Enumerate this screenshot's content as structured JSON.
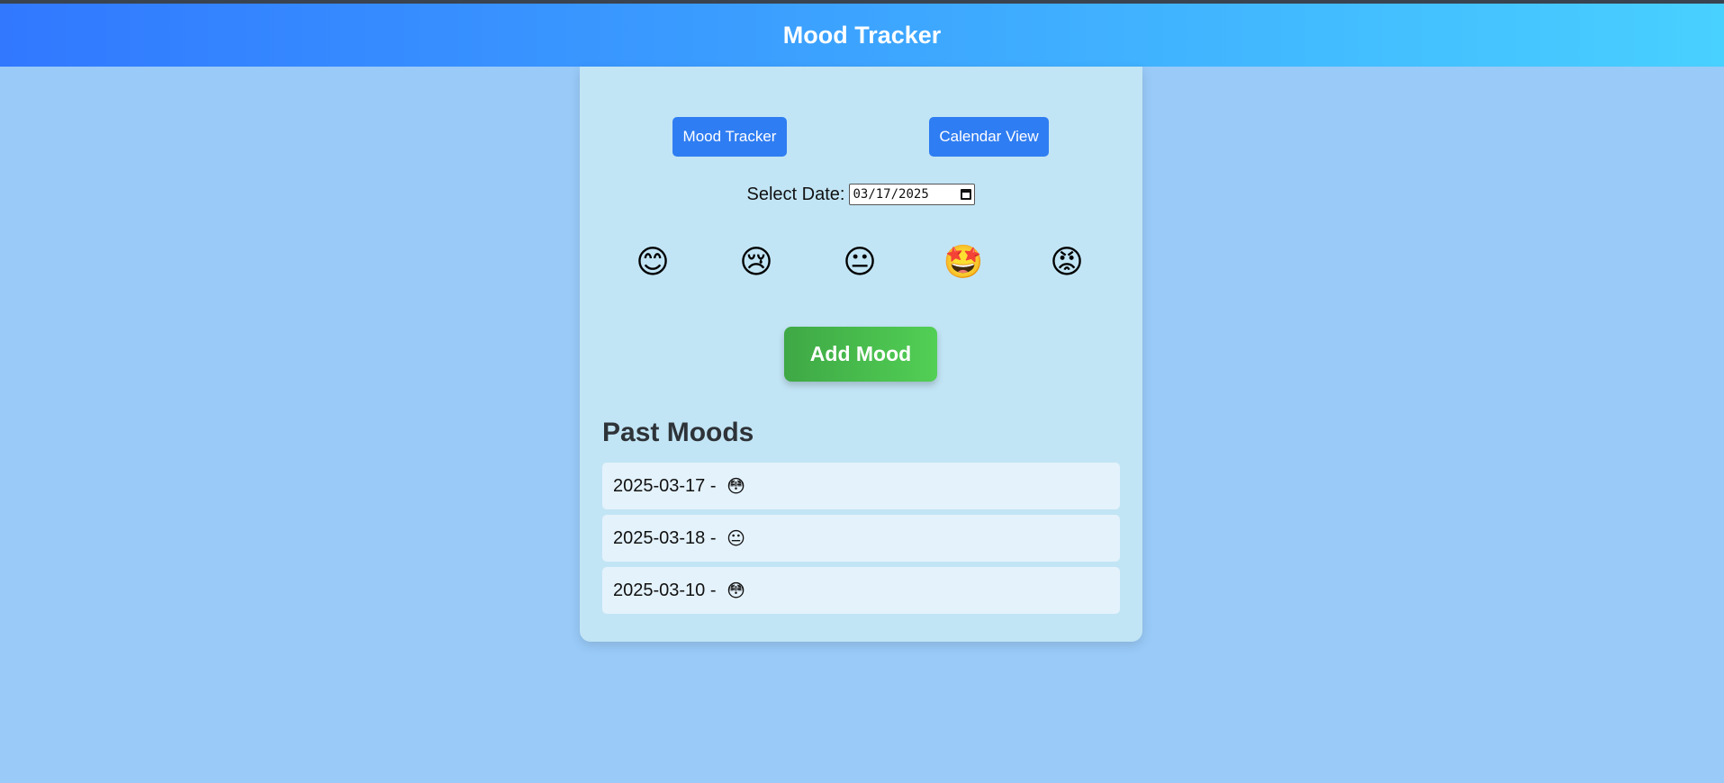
{
  "header": {
    "title": "Mood Tracker"
  },
  "nav": {
    "tracker_label": "Mood Tracker",
    "calendar_label": "Calendar View"
  },
  "date_picker": {
    "label": "Select Date:",
    "value": "03/17/2025",
    "icon": "calendar-icon"
  },
  "moods": [
    {
      "emoji": "😊",
      "name": "happy"
    },
    {
      "emoji": "😢",
      "name": "sad"
    },
    {
      "emoji": "😐",
      "name": "neutral"
    },
    {
      "emoji": "🤩",
      "name": "excited"
    },
    {
      "emoji": "😡",
      "name": "angry"
    }
  ],
  "add_button": {
    "label": "Add Mood"
  },
  "past": {
    "title": "Past Moods",
    "entries": [
      {
        "date": "2025-03-17",
        "separator": " - ",
        "emoji": "😳"
      },
      {
        "date": "2025-03-18",
        "separator": " - ",
        "emoji": "😐"
      },
      {
        "date": "2025-03-10",
        "separator": " - ",
        "emoji": "😳"
      }
    ]
  },
  "colors": {
    "page_bg": "#99caf8",
    "header_start": "#3178ff",
    "header_end": "#48d0ff",
    "card_bg": "#c2e5f5",
    "nav_button": "#2f7df2",
    "add_start": "#3ea845",
    "add_end": "#52cf55",
    "entry_bg": "#e4f2fb"
  }
}
